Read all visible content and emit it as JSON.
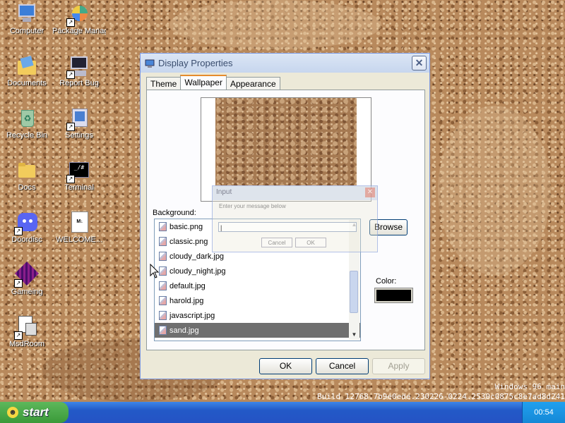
{
  "desktop": {
    "icons": [
      {
        "name": "computer-icon",
        "label": "Computer"
      },
      {
        "name": "package-manager-icon",
        "label": "Package Manager"
      },
      {
        "name": "documents-icon",
        "label": "Documents"
      },
      {
        "name": "report-bug-icon",
        "label": "Report Bug"
      },
      {
        "name": "recycle-bin-icon",
        "label": "Recycle Bin"
      },
      {
        "name": "settings-icon",
        "label": "Settings"
      },
      {
        "name": "docs-icon",
        "label": "Docs"
      },
      {
        "name": "terminal-icon",
        "label": "Terminal"
      },
      {
        "name": "doordisc-icon",
        "label": "Doordisc"
      },
      {
        "name": "welcome-icon",
        "label": "WELCOME..."
      },
      {
        "name": "gameing-icon",
        "label": "Gameing"
      },
      {
        "name": "msdroom-icon",
        "label": "MsdRoom"
      }
    ],
    "build_line1": "Windows 96 main",
    "build_line2": "Build 12768.7b9e0ede.230226-0224.2530c0875c8e7ad8d241"
  },
  "window": {
    "title": "Display Properties",
    "tabs": [
      "Theme",
      "Wallpaper",
      "Appearance"
    ],
    "active_tab": "Wallpaper",
    "background_label": "Background:",
    "files": [
      "basic.png",
      "classic.png",
      "cloudy_dark.jpg",
      "cloudy_night.jpg",
      "default.jpg",
      "harold.jpg",
      "javascript.jpg",
      "sand.jpg"
    ],
    "selected_file": "sand.jpg",
    "browse_label": "Browse",
    "color_label": "Color:",
    "color_value": "#000000",
    "ok_label": "OK",
    "cancel_label": "Cancel",
    "apply_label": "Apply"
  },
  "ghost_dialog": {
    "title": "Input",
    "message": "Enter your message below",
    "input_value": "|",
    "cancel_label": "Cancel",
    "ok_label": "OK"
  },
  "taskbar": {
    "start_label": "start",
    "clock": "00:54"
  }
}
